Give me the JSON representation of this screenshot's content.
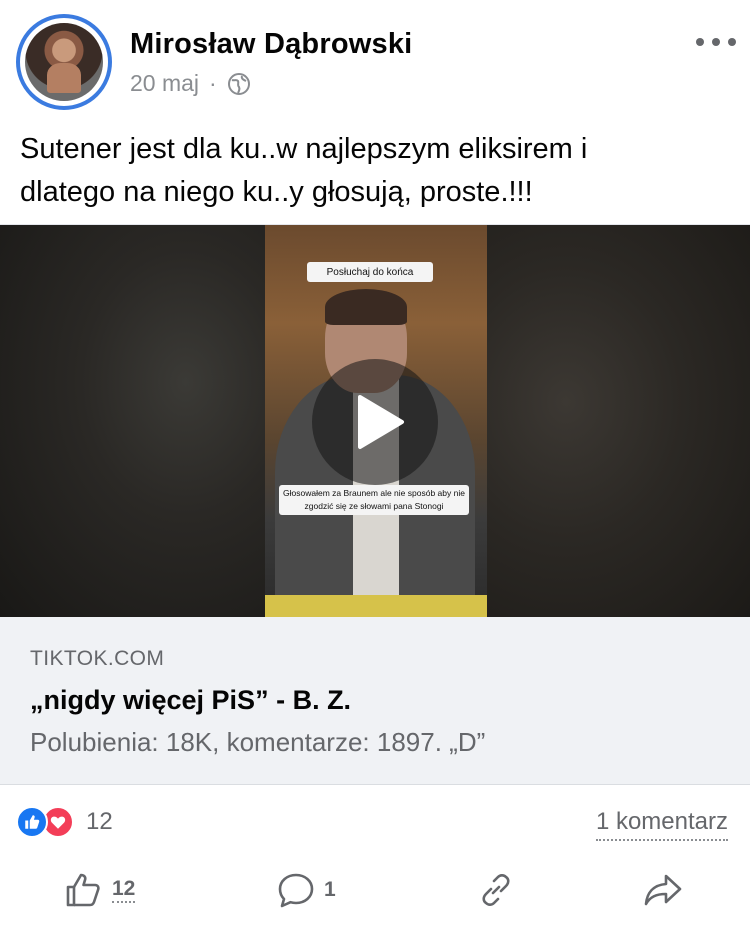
{
  "post": {
    "author": "Mirosław Dąbrowski",
    "date": "20 maj",
    "separator": "·",
    "privacy_icon": "globe-icon",
    "text_line1": "Sutener jest dla ku..w najlepszym eliksirem i",
    "text_line2": "dlatego na niego ku..y głosują, proste.!!!"
  },
  "video": {
    "caption_top": "Posłuchaj do końca",
    "caption_bottom": "Głosowałem za Braunem ale nie sposób aby nie zgodzić się ze słowami pana Stonogi"
  },
  "link_preview": {
    "domain": "TIKTOK.COM",
    "title": "„nigdy więcej PiS” - B. Z.",
    "description": "Polubienia: 18K, komentarze: 1897. „D”"
  },
  "engagement": {
    "reactions_count": "12",
    "comments_label": "1 komentarz",
    "like_count": "12",
    "comment_action_count": "1"
  },
  "colors": {
    "accent": "#1877f2",
    "love": "#f33e58",
    "secondary_text": "#65676b"
  }
}
